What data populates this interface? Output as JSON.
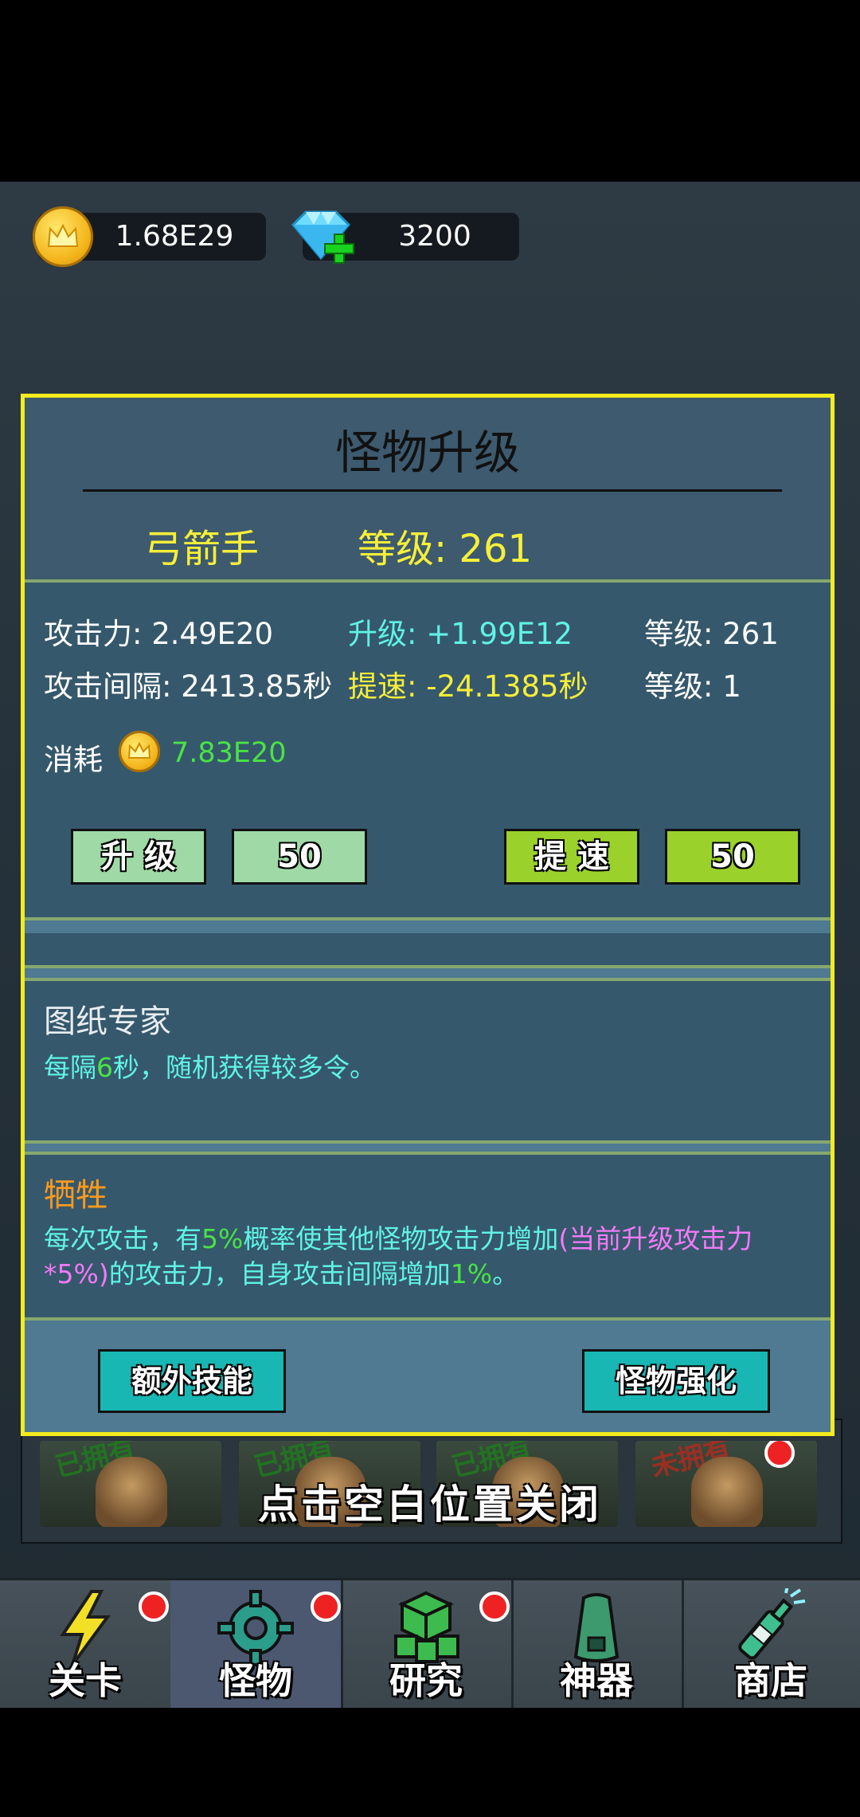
{
  "resources": {
    "gold": "1.68E29",
    "gems": "3200"
  },
  "panel": {
    "title": "怪物升级",
    "monster_name": "弓箭手",
    "level_header": "等级: 261",
    "stats": {
      "attack_label": "攻击力: 2.49E20",
      "upgrade_gain": "升级: +1.99E12",
      "attack_level": "等级: 261",
      "interval_label": "攻击间隔: 2413.85秒",
      "speed_gain": "提速: -24.1385秒",
      "speed_level": "等级: 1"
    },
    "cost": {
      "label": "消耗",
      "value": "7.83E20"
    },
    "buttons": {
      "upgrade": "升 级",
      "upgrade_amount": "50",
      "speedup": "提 速",
      "speedup_amount": "50",
      "extra_skill": "额外技能",
      "monster_enhance": "怪物强化"
    },
    "skill1": {
      "name": "图纸专家",
      "desc_a": "每隔",
      "desc_num": "6",
      "desc_b": "秒，随机获得较多令。"
    },
    "skill2": {
      "name": "牺牲",
      "desc_a": "每次攻击，有",
      "desc_pct": "5%",
      "desc_b": "概率使其他怪物攻击力增加",
      "desc_formula": "(当前升级攻击力*5%)",
      "desc_c": "的攻击力，自身攻击间隔增加",
      "desc_pct2": "1%",
      "desc_d": "。"
    }
  },
  "background": {
    "close_hint": "点击空白位置关闭",
    "cards": [
      "已拥有",
      "已拥有",
      "已拥有",
      "未拥有"
    ]
  },
  "nav": {
    "items": [
      {
        "label": "关卡",
        "icon": "lightning-icon"
      },
      {
        "label": "怪物",
        "icon": "gear-icon"
      },
      {
        "label": "研究",
        "icon": "cubes-icon"
      },
      {
        "label": "神器",
        "icon": "artifact-icon"
      },
      {
        "label": "商店",
        "icon": "bottle-icon"
      }
    ]
  },
  "colors": {
    "panel_border": "#f4ec1e",
    "panel_bg": "#3d5a6e",
    "accent_yellow": "#f6ee3a",
    "accent_cyan": "#5ff3e6",
    "accent_green": "#49e346",
    "accent_orange": "#ff9a1e",
    "accent_pink": "#f27af7"
  }
}
